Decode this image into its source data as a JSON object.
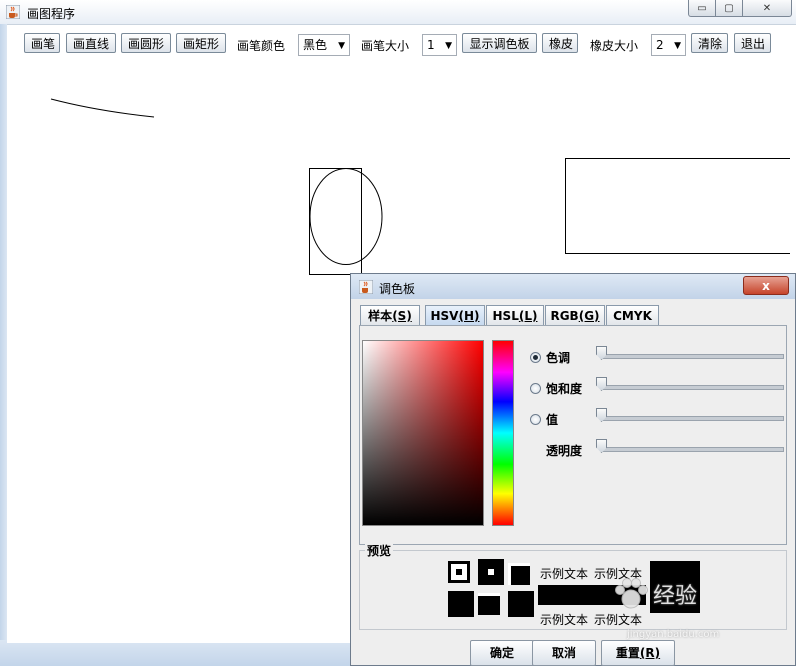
{
  "window": {
    "title": "画图程序",
    "min_glyph": "▭",
    "max_glyph": "▢",
    "close_glyph": "✕"
  },
  "toolbar": {
    "pen": "画笔",
    "line": "画直线",
    "circle": "画圆形",
    "rect": "画矩形",
    "pen_color_label": "画笔颜色",
    "pen_color_value": "黑色",
    "pen_size_label": "画笔大小",
    "pen_size_value": "1",
    "show_palette": "显示调色板",
    "eraser": "橡皮",
    "eraser_size_label": "橡皮大小",
    "eraser_size_value": "2",
    "clear": "清除",
    "exit": "退出"
  },
  "palette_dialog": {
    "title": "调色板",
    "close_glyph": "x",
    "tabs": [
      {
        "label": "样本",
        "mnemonic": "(S)"
      },
      {
        "label": "HSV",
        "mnemonic": "(H)"
      },
      {
        "label": "HSL",
        "mnemonic": "(L)"
      },
      {
        "label": "RGB",
        "mnemonic": "(G)"
      },
      {
        "label": "CMYK",
        "mnemonic": ""
      }
    ],
    "active_tab": "HSV",
    "sliders": [
      {
        "label": "色调",
        "radio": true,
        "selected": true,
        "value": 0
      },
      {
        "label": "饱和度",
        "radio": true,
        "selected": false,
        "value": 0
      },
      {
        "label": "值",
        "radio": true,
        "selected": false,
        "value": 0
      },
      {
        "label": "透明度",
        "radio": false,
        "selected": false,
        "value": 0
      }
    ],
    "preview_label": "预览",
    "sample_text": "示例文本",
    "buttons": {
      "ok": "确定",
      "cancel": "取消",
      "reset": "重置",
      "reset_mnemonic": "(R)"
    }
  },
  "watermark": {
    "name": "经验",
    "url": "jingyan.baidu.com"
  },
  "colors": {
    "stroke": "#000000",
    "accent_title": "#c6442b"
  }
}
